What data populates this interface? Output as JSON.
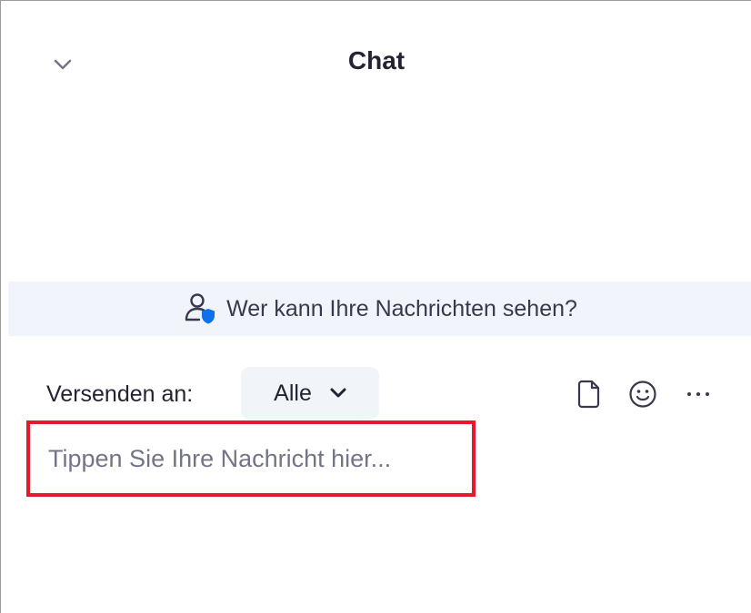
{
  "header": {
    "title": "Chat",
    "collapse_icon": "chevron-down-icon"
  },
  "privacy_banner": {
    "icon": "person-shield-icon",
    "text": "Wer kann Ihre Nachrichten sehen?",
    "shield_color": "#0e71eb"
  },
  "composer": {
    "send_label": "Versenden an:",
    "recipient": "Alle",
    "recipient_icon": "chevron-down-icon",
    "toolbar_icons": [
      "file-icon",
      "emoji-icon",
      "more-icon"
    ],
    "input_value": "",
    "input_placeholder": "Tippen Sie Ihre Nachricht hier...",
    "highlight_color": "#e8182c"
  }
}
